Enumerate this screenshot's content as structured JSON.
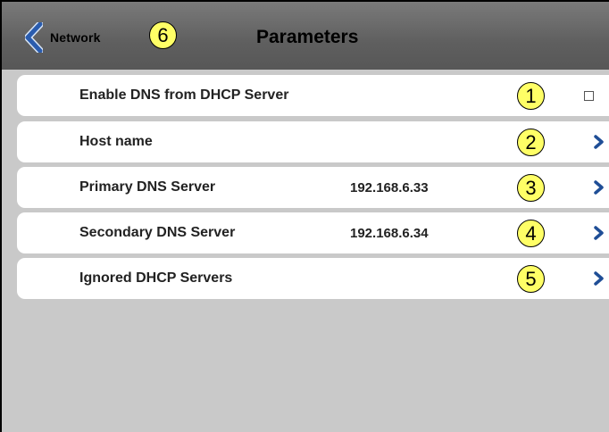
{
  "header": {
    "back_label": "Network",
    "back_callout": "6",
    "title": "Parameters"
  },
  "rows": [
    {
      "label": "Enable DNS from DHCP Server",
      "value": "",
      "callout": "1",
      "control": "checkbox",
      "checked": false
    },
    {
      "label": "Host name",
      "value": "",
      "callout": "2",
      "control": "chevron-right-icon"
    },
    {
      "label": "Primary DNS Server",
      "value": "192.168.6.33",
      "callout": "3",
      "control": "chevron-right-icon"
    },
    {
      "label": "Secondary DNS Server",
      "value": "192.168.6.34",
      "callout": "4",
      "control": "chevron-right-icon"
    },
    {
      "label": "Ignored DHCP Servers",
      "value": "",
      "callout": "5",
      "control": "chevron-right-icon"
    }
  ],
  "colors": {
    "header_bg": "#5f5f5f",
    "content_bg": "#c9c9c9",
    "row_bg": "#ffffff",
    "accent_blue": "#1f4e96",
    "callout_fill": "#ffff66"
  }
}
